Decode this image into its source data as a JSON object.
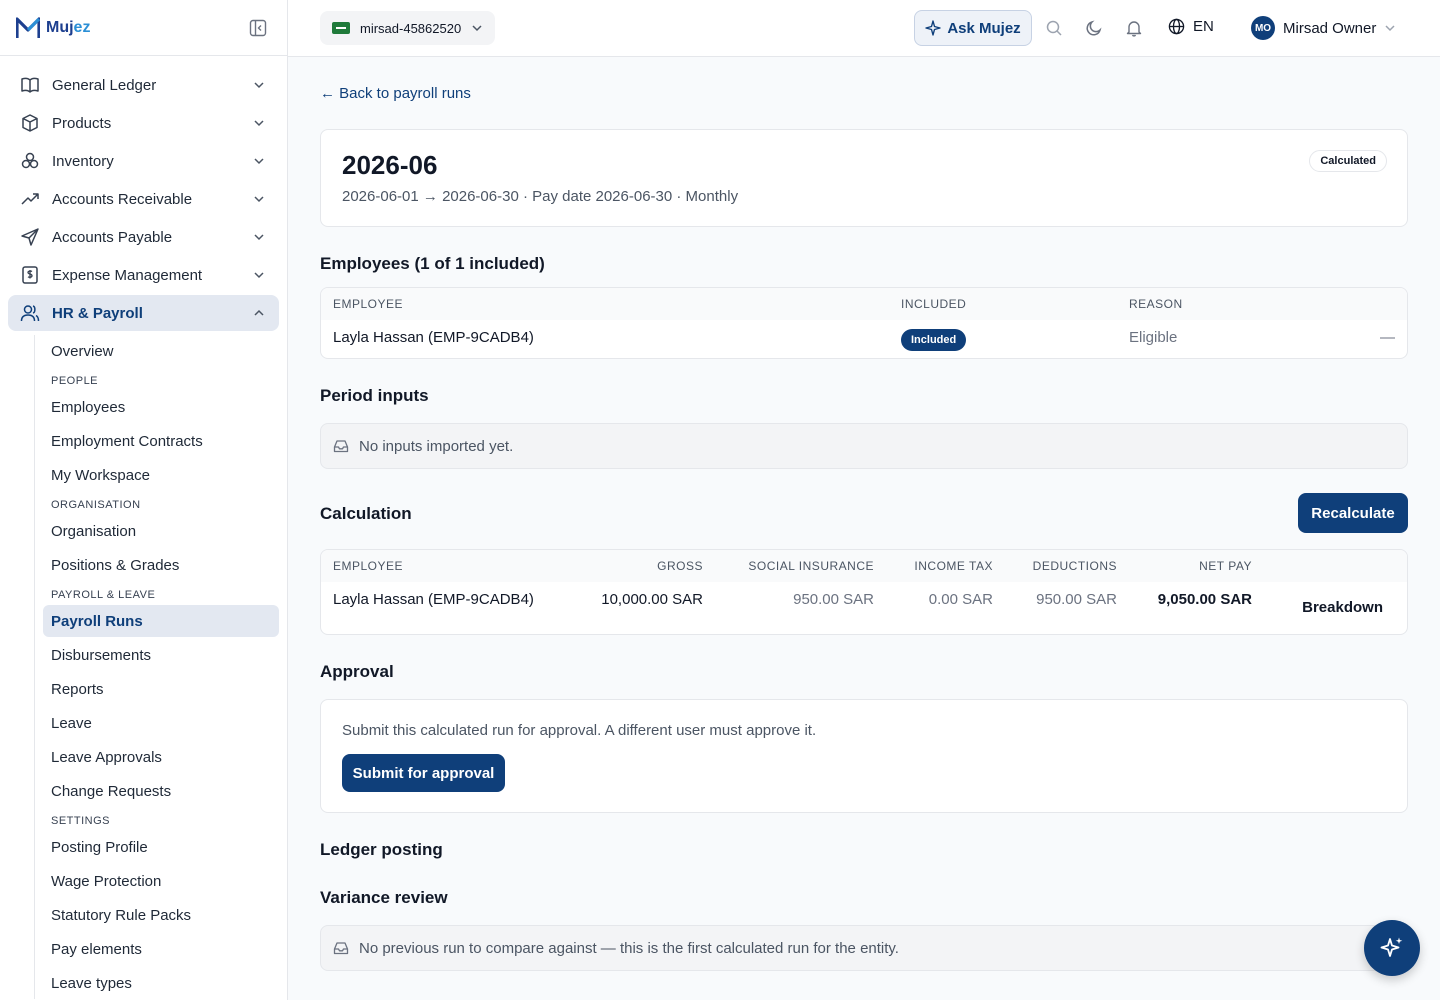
{
  "brand": {
    "name_main": "Muj",
    "name_accent": "ez"
  },
  "sidebar": {
    "items": [
      {
        "label": "General Ledger",
        "icon": "book-icon"
      },
      {
        "label": "Products",
        "icon": "box-icon"
      },
      {
        "label": "Inventory",
        "icon": "boxes-icon"
      },
      {
        "label": "Accounts Receivable",
        "icon": "trend-up-icon"
      },
      {
        "label": "Accounts Payable",
        "icon": "send-icon"
      },
      {
        "label": "Expense Management",
        "icon": "receipt-icon"
      },
      {
        "label": "HR & Payroll",
        "icon": "users-icon",
        "active": true
      }
    ],
    "sub": {
      "overview": "Overview",
      "people_head": "PEOPLE",
      "employees": "Employees",
      "contracts": "Employment Contracts",
      "workspace": "My Workspace",
      "org_head": "ORGANISATION",
      "organisation": "Organisation",
      "positions": "Positions & Grades",
      "payroll_head": "PAYROLL & LEAVE",
      "payroll_runs": "Payroll Runs",
      "disbursements": "Disbursements",
      "reports": "Reports",
      "leave": "Leave",
      "leave_approvals": "Leave Approvals",
      "change_requests": "Change Requests",
      "settings_head": "SETTINGS",
      "posting_profile": "Posting Profile",
      "wage_protection": "Wage Protection",
      "rule_packs": "Statutory Rule Packs",
      "pay_elements": "Pay elements",
      "leave_types": "Leave types"
    }
  },
  "topbar": {
    "org": "mirsad-45862520",
    "ask": "Ask Mujez",
    "lang": "EN",
    "avatar_initials": "MO",
    "user_name": "Mirsad Owner"
  },
  "page": {
    "back": "← Back to payroll runs",
    "run_title": "2026-06",
    "run_subtitle": "2026-06-01 → 2026-06-30 · Pay date 2026-06-30 · Monthly",
    "status": "Calculated"
  },
  "employees_section": {
    "title": "Employees (1 of 1 included)",
    "headers": [
      "EMPLOYEE",
      "INCLUDED",
      "REASON"
    ],
    "rows": [
      {
        "employee": "Layla Hassan (EMP-9CADB4)",
        "included": "Included",
        "reason": "Eligible",
        "action": "—"
      }
    ]
  },
  "period_inputs": {
    "title": "Period inputs",
    "empty": "No inputs imported yet."
  },
  "calculation": {
    "title": "Calculation",
    "recalc": "Recalculate",
    "headers": [
      "EMPLOYEE",
      "GROSS",
      "SOCIAL INSURANCE",
      "INCOME TAX",
      "DEDUCTIONS",
      "NET PAY"
    ],
    "rows": [
      {
        "employee": "Layla Hassan (EMP-9CADB4)",
        "gross": "10,000.00 SAR",
        "social": "950.00 SAR",
        "tax": "0.00 SAR",
        "deductions": "950.00 SAR",
        "net": "9,050.00 SAR",
        "action": "Breakdown"
      }
    ]
  },
  "approval": {
    "title": "Approval",
    "text": "Submit this calculated run for approval. A different user must approve it.",
    "button": "Submit for approval"
  },
  "ledger": {
    "title": "Ledger posting"
  },
  "variance": {
    "title": "Variance review",
    "empty": "No previous run to compare against — this is the first calculated run for the entity."
  },
  "colors": {
    "primary": "#0f3f7a",
    "active_bg": "#e3e8f1"
  }
}
